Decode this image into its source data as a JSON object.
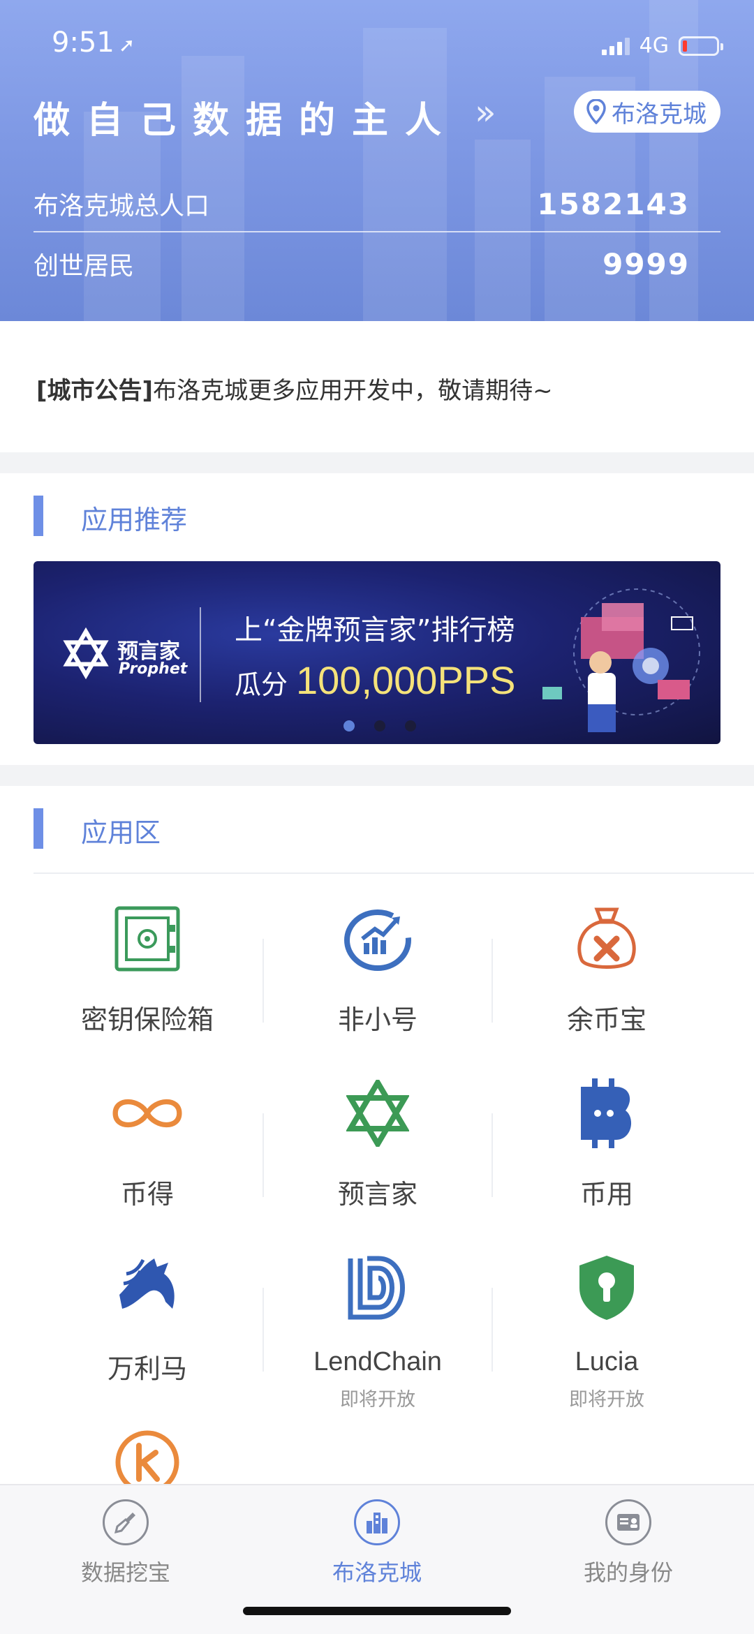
{
  "status_bar": {
    "time": "9:51",
    "network": "4G"
  },
  "header": {
    "slogan": "做自己数据的主人",
    "city_button": "布洛克城",
    "stats": [
      {
        "label": "布洛克城总人口",
        "value": "1582143"
      },
      {
        "label": "创世居民",
        "value": "9999"
      }
    ]
  },
  "notice": {
    "tag": "[城市公告]",
    "text": "布洛克城更多应用开发中，敬请期待~"
  },
  "recommend": {
    "title": "应用推荐",
    "banner": {
      "brand_cn": "预言家",
      "brand_en": "Prophet",
      "line1": "上“金牌预言家”排行榜",
      "line2_prefix": "瓜分",
      "line2_amount": "100,000PPS",
      "pages": 3,
      "active_page": 1
    }
  },
  "apps": {
    "title": "应用区",
    "items": [
      {
        "name": "密钥保险箱",
        "icon": "safe-icon",
        "color": "#3b9a5b"
      },
      {
        "name": "非小号",
        "icon": "chart-ring-icon",
        "color": "#3d6fbf"
      },
      {
        "name": "余币宝",
        "icon": "money-bag-icon",
        "color": "#d9683c"
      },
      {
        "name": "币得",
        "icon": "infinity-icon",
        "color": "#ea8a3c"
      },
      {
        "name": "预言家",
        "icon": "star-of-david-icon",
        "color": "#3c9a55"
      },
      {
        "name": "币用",
        "icon": "bitcoin-chat-icon",
        "color": "#3560b7"
      },
      {
        "name": "万利马",
        "icon": "horse-icon",
        "color": "#2f57b0"
      },
      {
        "name": "LendChain",
        "icon": "lendchain-icon",
        "color": "#3d6fbf",
        "sub": "即将开放"
      },
      {
        "name": "Lucia",
        "icon": "shield-keyhole-icon",
        "color": "#3c9a55",
        "sub": "即将开放"
      },
      {
        "name": "",
        "icon": "k-coin-icon",
        "color": "#ea8a3c"
      }
    ]
  },
  "tabbar": {
    "tabs": [
      {
        "label": "数据挖宝",
        "icon": "shovel-icon"
      },
      {
        "label": "布洛克城",
        "icon": "city-buildings-icon",
        "active": true
      },
      {
        "label": "我的身份",
        "icon": "id-card-icon"
      }
    ]
  },
  "colors": {
    "primary": "#5f82d9",
    "header_top": "#8fa8ee",
    "header_bottom": "#6c88d8",
    "gap": "#f2f3f5"
  }
}
